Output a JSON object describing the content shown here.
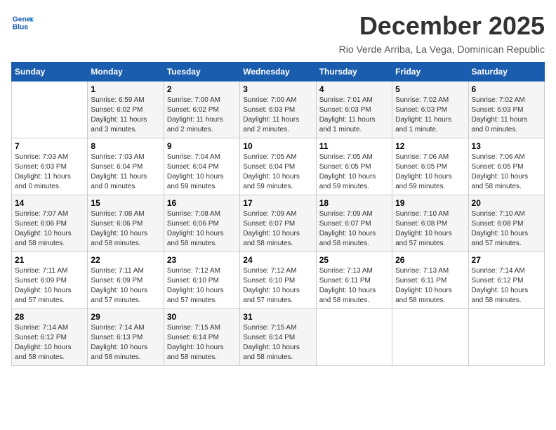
{
  "header": {
    "logo_line1": "General",
    "logo_line2": "Blue",
    "month_year": "December 2025",
    "location": "Rio Verde Arriba, La Vega, Dominican Republic"
  },
  "weekdays": [
    "Sunday",
    "Monday",
    "Tuesday",
    "Wednesday",
    "Thursday",
    "Friday",
    "Saturday"
  ],
  "weeks": [
    [
      {
        "day": "",
        "info": ""
      },
      {
        "day": "1",
        "info": "Sunrise: 6:59 AM\nSunset: 6:02 PM\nDaylight: 11 hours\nand 3 minutes."
      },
      {
        "day": "2",
        "info": "Sunrise: 7:00 AM\nSunset: 6:02 PM\nDaylight: 11 hours\nand 2 minutes."
      },
      {
        "day": "3",
        "info": "Sunrise: 7:00 AM\nSunset: 6:03 PM\nDaylight: 11 hours\nand 2 minutes."
      },
      {
        "day": "4",
        "info": "Sunrise: 7:01 AM\nSunset: 6:03 PM\nDaylight: 11 hours\nand 1 minute."
      },
      {
        "day": "5",
        "info": "Sunrise: 7:02 AM\nSunset: 6:03 PM\nDaylight: 11 hours\nand 1 minute."
      },
      {
        "day": "6",
        "info": "Sunrise: 7:02 AM\nSunset: 6:03 PM\nDaylight: 11 hours\nand 0 minutes."
      }
    ],
    [
      {
        "day": "7",
        "info": "Sunrise: 7:03 AM\nSunset: 6:03 PM\nDaylight: 11 hours\nand 0 minutes."
      },
      {
        "day": "8",
        "info": "Sunrise: 7:03 AM\nSunset: 6:04 PM\nDaylight: 11 hours\nand 0 minutes."
      },
      {
        "day": "9",
        "info": "Sunrise: 7:04 AM\nSunset: 6:04 PM\nDaylight: 10 hours\nand 59 minutes."
      },
      {
        "day": "10",
        "info": "Sunrise: 7:05 AM\nSunset: 6:04 PM\nDaylight: 10 hours\nand 59 minutes."
      },
      {
        "day": "11",
        "info": "Sunrise: 7:05 AM\nSunset: 6:05 PM\nDaylight: 10 hours\nand 59 minutes."
      },
      {
        "day": "12",
        "info": "Sunrise: 7:06 AM\nSunset: 6:05 PM\nDaylight: 10 hours\nand 59 minutes."
      },
      {
        "day": "13",
        "info": "Sunrise: 7:06 AM\nSunset: 6:05 PM\nDaylight: 10 hours\nand 58 minutes."
      }
    ],
    [
      {
        "day": "14",
        "info": "Sunrise: 7:07 AM\nSunset: 6:06 PM\nDaylight: 10 hours\nand 58 minutes."
      },
      {
        "day": "15",
        "info": "Sunrise: 7:08 AM\nSunset: 6:06 PM\nDaylight: 10 hours\nand 58 minutes."
      },
      {
        "day": "16",
        "info": "Sunrise: 7:08 AM\nSunset: 6:06 PM\nDaylight: 10 hours\nand 58 minutes."
      },
      {
        "day": "17",
        "info": "Sunrise: 7:09 AM\nSunset: 6:07 PM\nDaylight: 10 hours\nand 58 minutes."
      },
      {
        "day": "18",
        "info": "Sunrise: 7:09 AM\nSunset: 6:07 PM\nDaylight: 10 hours\nand 58 minutes."
      },
      {
        "day": "19",
        "info": "Sunrise: 7:10 AM\nSunset: 6:08 PM\nDaylight: 10 hours\nand 57 minutes."
      },
      {
        "day": "20",
        "info": "Sunrise: 7:10 AM\nSunset: 6:08 PM\nDaylight: 10 hours\nand 57 minutes."
      }
    ],
    [
      {
        "day": "21",
        "info": "Sunrise: 7:11 AM\nSunset: 6:09 PM\nDaylight: 10 hours\nand 57 minutes."
      },
      {
        "day": "22",
        "info": "Sunrise: 7:11 AM\nSunset: 6:09 PM\nDaylight: 10 hours\nand 57 minutes."
      },
      {
        "day": "23",
        "info": "Sunrise: 7:12 AM\nSunset: 6:10 PM\nDaylight: 10 hours\nand 57 minutes."
      },
      {
        "day": "24",
        "info": "Sunrise: 7:12 AM\nSunset: 6:10 PM\nDaylight: 10 hours\nand 57 minutes."
      },
      {
        "day": "25",
        "info": "Sunrise: 7:13 AM\nSunset: 6:11 PM\nDaylight: 10 hours\nand 58 minutes."
      },
      {
        "day": "26",
        "info": "Sunrise: 7:13 AM\nSunset: 6:11 PM\nDaylight: 10 hours\nand 58 minutes."
      },
      {
        "day": "27",
        "info": "Sunrise: 7:14 AM\nSunset: 6:12 PM\nDaylight: 10 hours\nand 58 minutes."
      }
    ],
    [
      {
        "day": "28",
        "info": "Sunrise: 7:14 AM\nSunset: 6:12 PM\nDaylight: 10 hours\nand 58 minutes."
      },
      {
        "day": "29",
        "info": "Sunrise: 7:14 AM\nSunset: 6:13 PM\nDaylight: 10 hours\nand 58 minutes."
      },
      {
        "day": "30",
        "info": "Sunrise: 7:15 AM\nSunset: 6:14 PM\nDaylight: 10 hours\nand 58 minutes."
      },
      {
        "day": "31",
        "info": "Sunrise: 7:15 AM\nSunset: 6:14 PM\nDaylight: 10 hours\nand 58 minutes."
      },
      {
        "day": "",
        "info": ""
      },
      {
        "day": "",
        "info": ""
      },
      {
        "day": "",
        "info": ""
      }
    ]
  ]
}
